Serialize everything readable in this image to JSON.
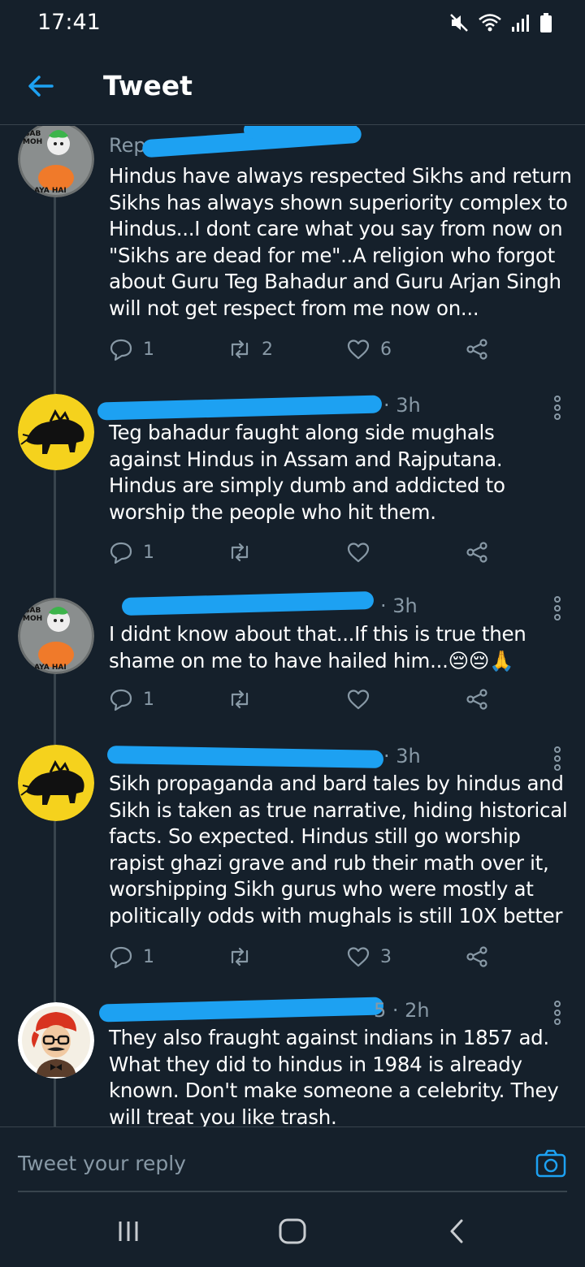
{
  "status_bar": {
    "time": "17:41"
  },
  "header": {
    "title": "Tweet"
  },
  "colors": {
    "background": "#15202b",
    "accent": "#1da1f2",
    "muted": "#8899a6",
    "divider": "#38444d",
    "redaction": "#1da1f2"
  },
  "tweets": [
    {
      "avatar": "sab-moh-maya-hai-cartoon",
      "meta": "Rep",
      "body": "Hindus have always respected Sikhs and return Sikhs has always shown superiority complex to Hindus...I dont care what you say from now on \"Sikhs are dead for me\"..A religion who forgot about Guru Teg Bahadur and Guru Arjan Singh will not get respect from me now on...",
      "replies": "1",
      "retweets": "2",
      "likes": "6"
    },
    {
      "avatar": "boar-on-yellow",
      "meta": "· 3h",
      "body": "Teg bahadur faught along side mughals against Hindus in Assam and Rajputana. Hindus are simply dumb and addicted to worship the people who hit them.",
      "replies": "1",
      "retweets": "",
      "likes": ""
    },
    {
      "avatar": "sab-moh-maya-hai-cartoon",
      "meta": "· 3h",
      "body": "I didnt know about that...If this is true then shame on me to have hailed him...😔😔🙏",
      "replies": "1",
      "retweets": "",
      "likes": ""
    },
    {
      "avatar": "boar-on-yellow",
      "meta": "· 3h",
      "body": "Sikh propaganda and bard tales by hindus and Sikh is taken as true narrative, hiding historical facts. So expected. Hindus still go worship rapist ghazi grave and rub their math over it,  worshipping Sikh gurus who were mostly at politically odds with mughals is still 10X better",
      "replies": "1",
      "retweets": "",
      "likes": "3"
    },
    {
      "avatar": "man-in-red-turban",
      "meta": "5 · 2h",
      "body": "They also fraught against indians in 1857 ad. What they did to hindus in 1984 is already known. Don't make someone a celebrity. They will treat you like trash.",
      "replies": "",
      "retweets": "",
      "likes": ""
    }
  ],
  "reply_bar": {
    "placeholder": "Tweet your reply"
  }
}
